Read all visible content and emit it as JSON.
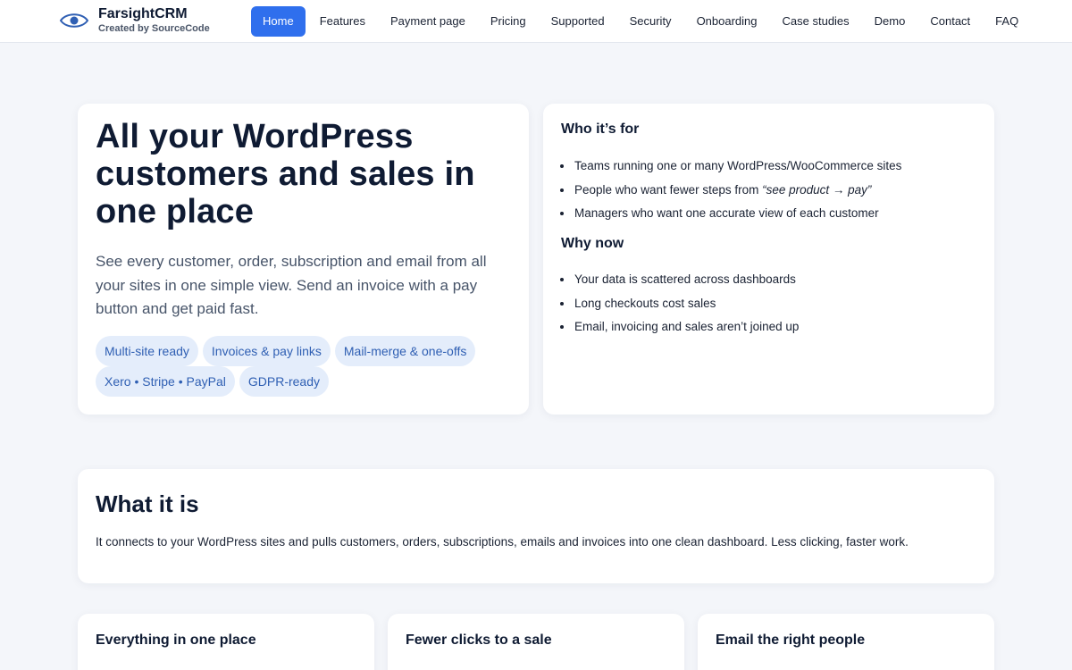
{
  "header": {
    "brand_name": "FarsightCRM",
    "brand_sub": "Created by SourceCode",
    "logo_icon": "eye-icon",
    "accent": "#2f6fed",
    "nav": [
      {
        "label": "Home",
        "active": true
      },
      {
        "label": "Features"
      },
      {
        "label": "Payment page"
      },
      {
        "label": "Pricing"
      },
      {
        "label": "Supported"
      },
      {
        "label": "Security"
      },
      {
        "label": "Onboarding"
      },
      {
        "label": "Case studies"
      },
      {
        "label": "Demo"
      },
      {
        "label": "Contact"
      },
      {
        "label": "FAQ"
      }
    ]
  },
  "hero": {
    "title": "All your WordPress customers and sales in one place",
    "text": "See every customer, order, subscription and email from all your sites in one simple view. Send an invoice with a pay button and get paid fast.",
    "chips": [
      "Multi-site ready",
      "Invoices & pay links",
      "Mail-merge & one-offs",
      "Xero • Stripe • PayPal",
      "GDPR-ready"
    ]
  },
  "who": {
    "heading": "Who it’s for",
    "items": [
      "Teams running one or many WordPress/WooCommerce sites",
      "People who want fewer steps from ",
      "Managers who want one accurate view of each customer"
    ],
    "item2_em": "“see product → pay”",
    "why_heading": "Why now",
    "why_items": [
      "Your data is scattered across dashboards",
      "Long checkouts cost sales",
      "Email, invoicing and sales aren’t joined up"
    ]
  },
  "what": {
    "heading": "What it is",
    "text": "It connects to your WordPress sites and pulls customers, orders, subscriptions, emails and invoices into one clean dashboard. Less clicking, faster work."
  },
  "features": [
    {
      "title": "Everything in one place"
    },
    {
      "title": "Fewer clicks to a sale"
    },
    {
      "title": "Email the right people"
    }
  ]
}
